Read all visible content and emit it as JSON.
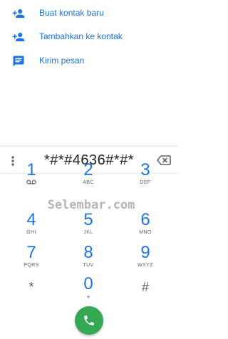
{
  "suggestions": [
    {
      "label": "Buat kontak baru",
      "icon": "add-person-icon"
    },
    {
      "label": "Tambahkan ke kontak",
      "icon": "add-person-icon"
    },
    {
      "label": "Kirim pesan",
      "icon": "message-icon"
    }
  ],
  "dialer": {
    "number": "*#*#4636#*#*",
    "menu_icon": "more-vert-icon",
    "backspace_icon": "backspace-icon",
    "call_icon": "phone-icon",
    "keys": [
      {
        "digit": "1",
        "letters": "voicemail-icon"
      },
      {
        "digit": "2",
        "letters": "ABC"
      },
      {
        "digit": "3",
        "letters": "DEF"
      },
      {
        "digit": "4",
        "letters": "GHI"
      },
      {
        "digit": "5",
        "letters": "JKL"
      },
      {
        "digit": "6",
        "letters": "MNO"
      },
      {
        "digit": "7",
        "letters": "PQRS"
      },
      {
        "digit": "8",
        "letters": "TUV"
      },
      {
        "digit": "9",
        "letters": "WXYZ"
      },
      {
        "digit": "*",
        "letters": ""
      },
      {
        "digit": "0",
        "letters": "+"
      },
      {
        "digit": "#",
        "letters": ""
      }
    ]
  },
  "watermark": "Selembar.com",
  "colors": {
    "accent": "#1a73e8",
    "call_button": "#34a853",
    "secondary_text": "#5f6368"
  }
}
